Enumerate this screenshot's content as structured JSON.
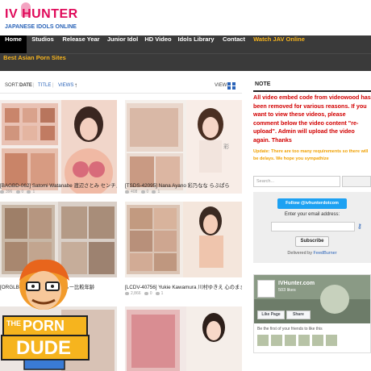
{
  "site": {
    "logo_title": "IV HUNTER",
    "logo_subtitle": "JAPANESE IDOLS ONLINE"
  },
  "nav": {
    "row1": [
      {
        "label": "Home",
        "active": true
      },
      {
        "label": "Studios"
      },
      {
        "label": "Release Year"
      },
      {
        "label": "Junior Idol"
      },
      {
        "label": "HD Video"
      },
      {
        "label": "Idols Library"
      },
      {
        "label": "Contact"
      },
      {
        "label": "Watch JAV Online",
        "accent": true
      }
    ],
    "row2": [
      {
        "label": "Best Asian Porn Sites",
        "accent": true
      }
    ]
  },
  "sortbar": {
    "sort_label": "SORT:",
    "date": "DATE",
    "sep1": "|",
    "title": "TITLE",
    "sep2": "|",
    "views": "VIEWS",
    "arrow": "↑",
    "view_label": "VIEW:"
  },
  "posts": [
    {
      "title": "[BAGBD-062] Satomi Watanabe 渡辺さとみ センチメンタル",
      "views": "396",
      "comments": "0",
      "likes": "1"
    },
    {
      "title": "[TSDS-42095] Nana Ayano 彩乃なな らぶぱら",
      "views": "408",
      "comments": "0",
      "likes": "1"
    },
    {
      "title": "[ORGLB-021] 上空羽 制服ならー比較年齢",
      "views": "",
      "comments": "",
      "likes": ""
    },
    {
      "title": "[LCDV-40756] Yukie Kawamura 川村ゆきえ 心のままに",
      "views": "2,866",
      "comments": "0",
      "likes": "1"
    }
  ],
  "sidebar": {
    "note_heading": "NOTE",
    "note_body": "All video embed code from videowood has been removed for various reasons. If you want to view these videos, please comment below the video content \"re-upload\". Admin will upload the video again. Thanks",
    "note_update": "Update: There are too many requirements so there will be delays. We hope you sympathize",
    "search_placeholder": "Search...",
    "follow_label": "Follow @ivhunterdotcom",
    "email_label": "Enter your email address:",
    "subscribe_label": "Subscribe",
    "delivered_prefix": "Delivered by",
    "delivered_brand": "FeedBurner",
    "fb_name": "IVHunter.com",
    "fb_likes": "503 likes",
    "fb_like": "Like Page",
    "fb_share": "Share",
    "fb_first": "Be the first of your friends to like this"
  },
  "badge": {
    "line1": "THE",
    "line2": "PORN",
    "line3": "DUDE"
  },
  "colors": {
    "nav_bg": "#3a3a3a",
    "accent": "#f6b41e",
    "brand_pink": "#e00a5a",
    "note_red": "#d20000",
    "twitter": "#1da1f2"
  }
}
